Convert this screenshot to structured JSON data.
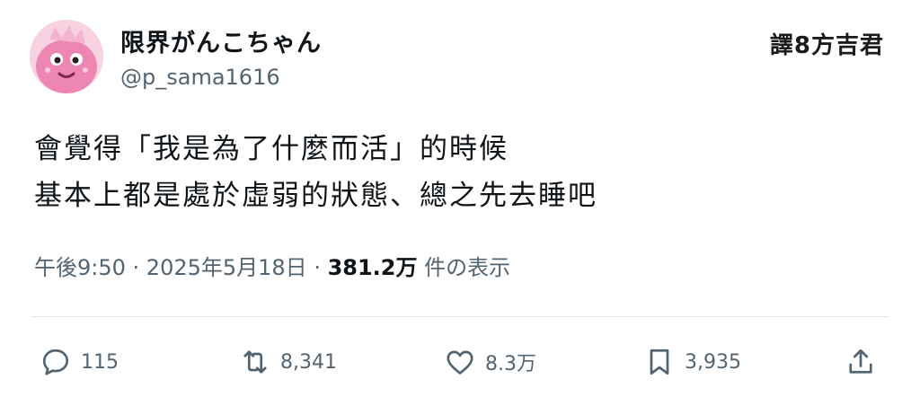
{
  "author": {
    "display_name": "限界がんこちゃん",
    "handle": "@p_sama1616"
  },
  "watermark": "譯8方吉君",
  "post": {
    "lines": [
      "會覺得「我是為了什麼而活」的時候",
      "基本上都是處於虛弱的狀態、總之先去睡吧"
    ]
  },
  "meta": {
    "time": "午後9:50",
    "separator1": " · ",
    "date": "2025年5月18日",
    "separator2": " · ",
    "views_count": "381.2万",
    "views_label": " 件の表示"
  },
  "actions": {
    "reply": {
      "icon": "reply-icon",
      "count": "115"
    },
    "repost": {
      "icon": "repost-icon",
      "count": "8,341"
    },
    "like": {
      "icon": "heart-icon",
      "count": "8.3万"
    },
    "bookmark": {
      "icon": "bookmark-icon",
      "count": "3,935"
    },
    "share": {
      "icon": "share-icon"
    }
  },
  "colors": {
    "text": "#0f1419",
    "secondary": "#536471",
    "divider": "#e7e9ea",
    "avatar_pink": "#f08cb4"
  }
}
